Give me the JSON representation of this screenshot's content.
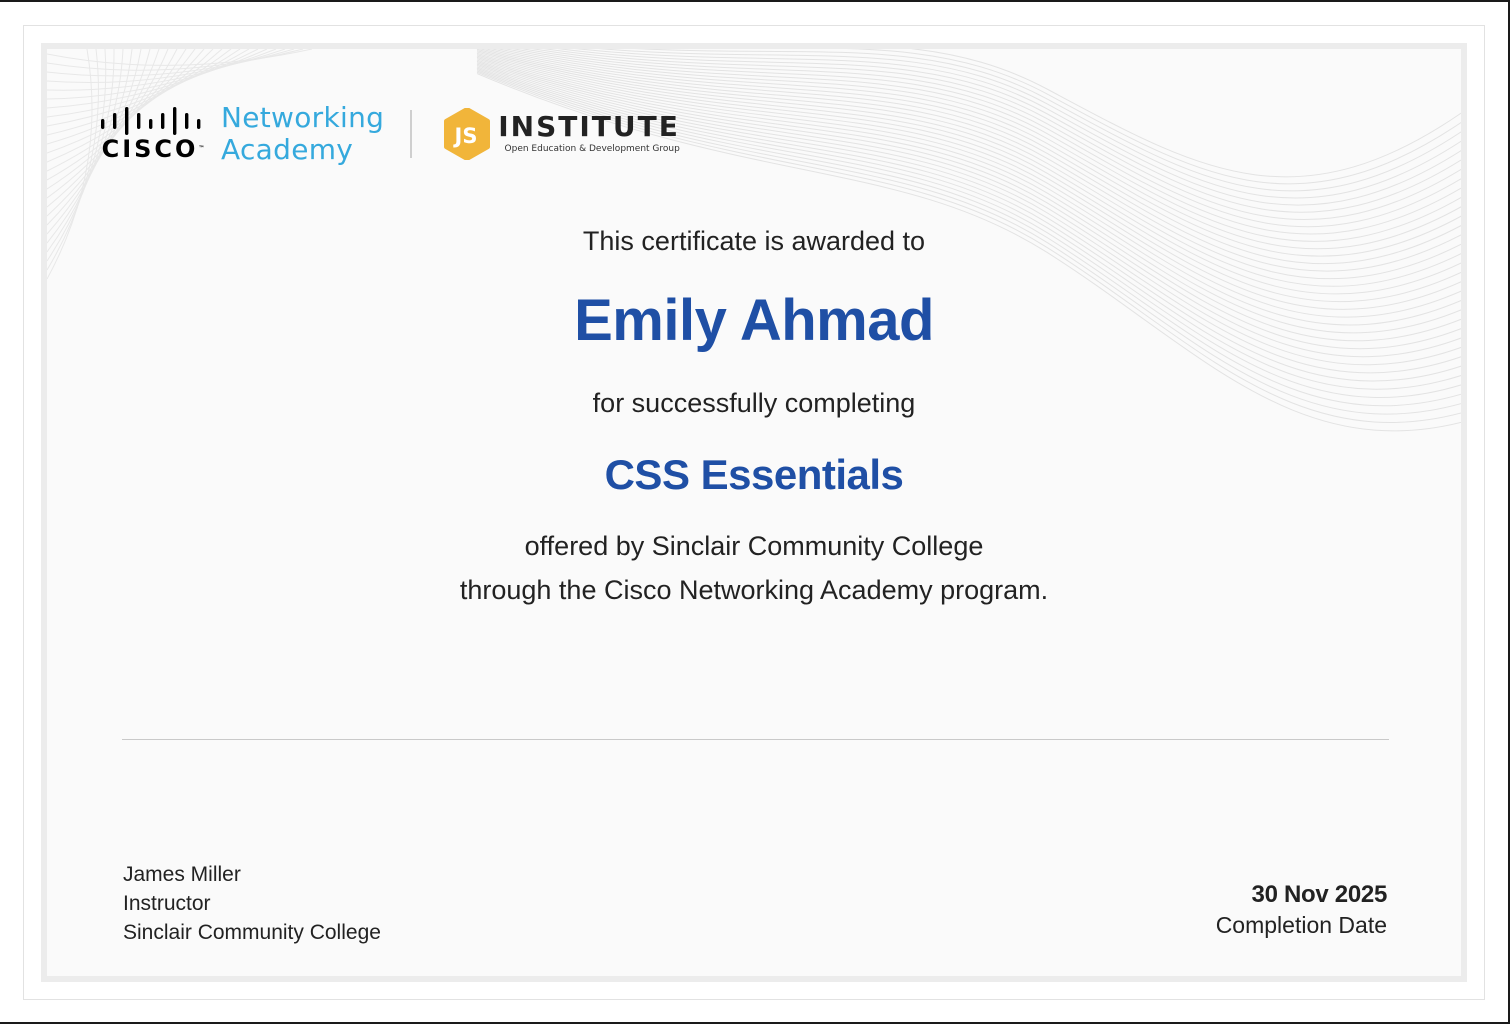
{
  "logos": {
    "cisco_wordmark": "CISCO",
    "cisco_trademark": "™",
    "netacad_line1": "Networking",
    "netacad_line2": "Academy",
    "jsi_badge": "JS",
    "jsi_title": "INSTITUTE",
    "jsi_subtitle": "Open Education & Development Group"
  },
  "certificate": {
    "awarded_to_text": "This certificate is awarded to",
    "recipient_name": "Emily Ahmad",
    "completing_text": "for successfully completing",
    "course_name": "CSS Essentials",
    "offered_line": "offered by Sinclair Community College",
    "program_line": "through the Cisco Networking Academy program."
  },
  "signer": {
    "name": "James Miller",
    "title": "Instructor",
    "organization": "Sinclair Community College"
  },
  "completion": {
    "date": "30 Nov 2025",
    "label": "Completion Date"
  },
  "colors": {
    "accent_blue": "#1f4fa5",
    "netacad_cyan": "#35a9dd",
    "jsi_yellow": "#f1b53a",
    "frame_gray": "#ececec"
  },
  "icons": {
    "cisco_logo": "cisco-bridge-bars-icon",
    "jsi_logo": "js-hexagon-badge-icon"
  }
}
